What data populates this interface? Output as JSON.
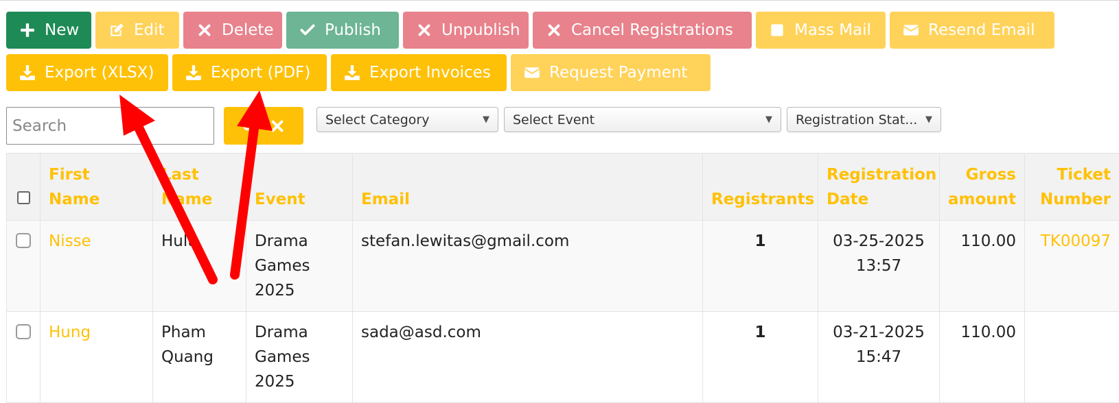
{
  "toolbar": {
    "new_label": "New",
    "edit_label": "Edit",
    "delete_label": "Delete",
    "publish_label": "Publish",
    "unpublish_label": "Unpublish",
    "cancel_registrations_label": "Cancel Registrations",
    "mass_mail_label": "Mass Mail",
    "resend_email_label": "Resend Email",
    "export_xlsx_label": "Export (XLSX)",
    "export_pdf_label": "Export (PDF)",
    "export_invoices_label": "Export Invoices",
    "request_payment_label": "Request Payment"
  },
  "filters": {
    "search_placeholder": "Search",
    "category_select": "Select Category",
    "event_select": "Select Event",
    "status_select": "Registration Stat..."
  },
  "table": {
    "headers": {
      "first_name": "First Name",
      "last_name": "Last Name",
      "event": "Event",
      "email": "Email",
      "registrants": "Registrants",
      "registration_date": "Registration Date",
      "gross_amount": "Gross amount",
      "ticket_number": "Ticket Number"
    },
    "rows": [
      {
        "first_name": "Nisse",
        "last_name": "Hult",
        "event": "Drama Games 2025",
        "email": "stefan.lewitas@gmail.com",
        "registrants": "1",
        "registration_date": "03-25-2025 13:57",
        "gross_amount": "110.00",
        "ticket_number": "TK00097"
      },
      {
        "first_name": "Hung",
        "last_name": "Pham Quang",
        "event": "Drama Games 2025",
        "email": "sada@asd.com",
        "registrants": "1",
        "registration_date": "03-21-2025 15:47",
        "gross_amount": "110.00",
        "ticket_number": ""
      }
    ]
  },
  "colors": {
    "success": "#1e8a56",
    "warning": "#ffc107",
    "warning_light": "#ffd259",
    "danger": "#e8828c",
    "info": "#6db594",
    "annotation_arrow": "#ff0000"
  },
  "icons": {
    "new": "plus-icon",
    "edit": "edit-icon",
    "delete": "close-icon",
    "publish": "check-icon",
    "unpublish": "close-icon",
    "cancel": "close-icon",
    "mass_mail": "square-icon",
    "resend_email": "envelope-icon",
    "export": "download-icon",
    "request_payment": "envelope-icon",
    "search": "search-icon",
    "clear": "close-icon"
  }
}
